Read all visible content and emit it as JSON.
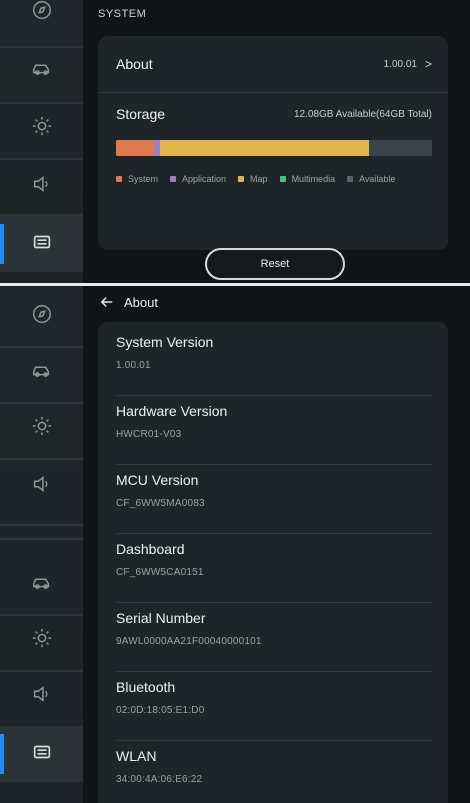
{
  "panel_top": {
    "section_label": "SYSTEM",
    "about": {
      "label": "About",
      "version": "1.00.01",
      "chevron": ">"
    },
    "storage": {
      "label": "Storage",
      "summary": "12.08GB Available(64GB Total)",
      "usage": [
        {
          "name": "System",
          "fraction": 0.12,
          "color": "#e07a4c"
        },
        {
          "name": "Application",
          "fraction": 0.02,
          "color": "#9a7fc9"
        },
        {
          "name": "Map",
          "fraction": 0.66,
          "color": "#e4b54e"
        },
        {
          "name": "Multimedia",
          "fraction": 0.0,
          "color": "#4fc27a"
        },
        {
          "name": "Available",
          "fraction": 0.2,
          "color": "#3b4447"
        }
      ],
      "legend": [
        "System",
        "Application",
        "Map",
        "Multimedia",
        "Available"
      ]
    },
    "reset_label": "Reset"
  },
  "panel_bottom": {
    "header_title": "About",
    "back_icon": "arrow-left-icon",
    "rows": [
      {
        "label": "System Version",
        "value": "1.00.01"
      },
      {
        "label": "Hardware Version",
        "value": "HWCR01-V03"
      },
      {
        "label": "MCU Version",
        "value": "CF_6WW5MA0083"
      },
      {
        "label": "Dashboard",
        "value": "CF_6WW5CA0151"
      },
      {
        "label": "Serial Number",
        "value": "9AWL0000AA21F00040000101"
      },
      {
        "label": "Bluetooth",
        "value": "02:0D:18:05:E1:D0"
      },
      {
        "label": "WLAN",
        "value": "34:00:4A:06:E6:22"
      }
    ]
  },
  "sidebar_icons": [
    "compass-icon",
    "car-icon",
    "brightness-icon",
    "volume-icon",
    "system-card-icon"
  ],
  "colors": {
    "accent": "#1e8cff",
    "background": "#101416",
    "card": "#1e2528",
    "sidebar": "#20272a"
  }
}
